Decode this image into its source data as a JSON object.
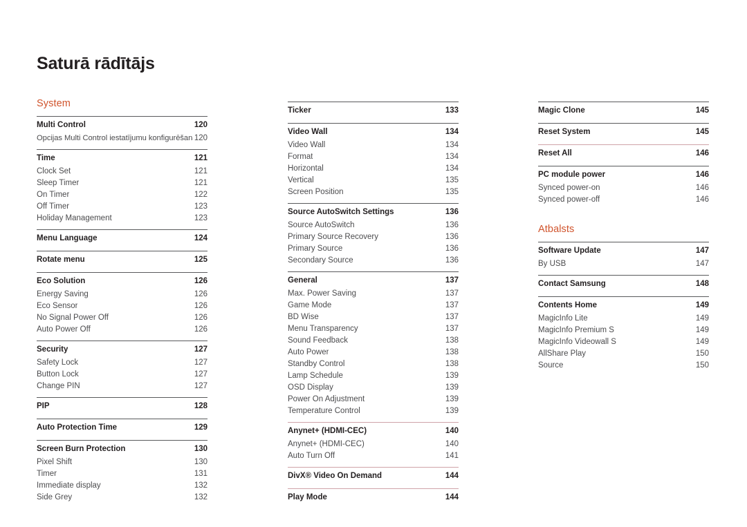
{
  "document": {
    "title": "Saturā rādītājs"
  },
  "colors": {
    "accent": "#d0532b",
    "rule": "#58595b",
    "rule_rose": "#cfa3a8",
    "text": "#231f20",
    "text_sub": "#4b4b4d",
    "background": "#ffffff"
  },
  "columns": [
    {
      "name": "column-left",
      "sections": [
        {
          "heading": "System",
          "groups": [
            {
              "rule": "dark",
              "rows": [
                {
                  "type": "main",
                  "label": "Multi Control",
                  "page": "120"
                },
                {
                  "type": "sub",
                  "label": "Opcijas Multi Control iestatījumu konfigurēšana",
                  "page": "120",
                  "tight": true
                }
              ]
            },
            {
              "rule": "dark",
              "rows": [
                {
                  "type": "main",
                  "label": "Time",
                  "page": "121"
                },
                {
                  "type": "sub",
                  "label": "Clock Set",
                  "page": "121"
                },
                {
                  "type": "sub",
                  "label": "Sleep Timer",
                  "page": "121"
                },
                {
                  "type": "sub",
                  "label": "On Timer",
                  "page": "122"
                },
                {
                  "type": "sub",
                  "label": "Off Timer",
                  "page": "123"
                },
                {
                  "type": "sub",
                  "label": "Holiday Management",
                  "page": "123"
                }
              ]
            },
            {
              "rule": "dark",
              "rows": [
                {
                  "type": "main",
                  "label": "Menu Language",
                  "page": "124"
                }
              ]
            },
            {
              "rule": "dark",
              "rows": [
                {
                  "type": "main",
                  "label": "Rotate menu",
                  "page": "125"
                }
              ]
            },
            {
              "rule": "dark",
              "rows": [
                {
                  "type": "main",
                  "label": "Eco Solution",
                  "page": "126"
                },
                {
                  "type": "sub",
                  "label": "Energy Saving",
                  "page": "126"
                },
                {
                  "type": "sub",
                  "label": "Eco Sensor",
                  "page": "126"
                },
                {
                  "type": "sub",
                  "label": "No Signal Power Off",
                  "page": "126"
                },
                {
                  "type": "sub",
                  "label": "Auto Power Off",
                  "page": "126"
                }
              ]
            },
            {
              "rule": "dark",
              "rows": [
                {
                  "type": "main",
                  "label": "Security",
                  "page": "127"
                },
                {
                  "type": "sub",
                  "label": "Safety Lock",
                  "page": "127"
                },
                {
                  "type": "sub",
                  "label": "Button Lock",
                  "page": "127"
                },
                {
                  "type": "sub",
                  "label": "Change PIN",
                  "page": "127"
                }
              ]
            },
            {
              "rule": "dark",
              "rows": [
                {
                  "type": "main",
                  "label": "PIP",
                  "page": "128"
                }
              ]
            },
            {
              "rule": "dark",
              "rows": [
                {
                  "type": "main",
                  "label": "Auto Protection Time",
                  "page": "129"
                }
              ]
            },
            {
              "rule": "dark",
              "rows": [
                {
                  "type": "main",
                  "label": "Screen Burn Protection",
                  "page": "130"
                },
                {
                  "type": "sub",
                  "label": "Pixel Shift",
                  "page": "130"
                },
                {
                  "type": "sub",
                  "label": "Timer",
                  "page": "131"
                },
                {
                  "type": "sub",
                  "label": "Immediate display",
                  "page": "132"
                },
                {
                  "type": "sub",
                  "label": "Side Grey",
                  "page": "132"
                }
              ]
            }
          ]
        }
      ]
    },
    {
      "name": "column-middle",
      "sections": [
        {
          "heading": "",
          "groups": [
            {
              "rule": "dark",
              "rows": [
                {
                  "type": "main",
                  "label": "Ticker",
                  "page": "133"
                }
              ]
            },
            {
              "rule": "dark",
              "rows": [
                {
                  "type": "main",
                  "label": "Video Wall",
                  "page": "134"
                },
                {
                  "type": "sub",
                  "label": "Video Wall",
                  "page": "134"
                },
                {
                  "type": "sub",
                  "label": "Format",
                  "page": "134"
                },
                {
                  "type": "sub",
                  "label": "Horizontal",
                  "page": "134"
                },
                {
                  "type": "sub",
                  "label": "Vertical",
                  "page": "135"
                },
                {
                  "type": "sub",
                  "label": "Screen Position",
                  "page": "135"
                }
              ]
            },
            {
              "rule": "dark",
              "rows": [
                {
                  "type": "main",
                  "label": "Source AutoSwitch Settings",
                  "page": "136"
                },
                {
                  "type": "sub",
                  "label": "Source AutoSwitch",
                  "page": "136"
                },
                {
                  "type": "sub",
                  "label": "Primary Source Recovery",
                  "page": "136"
                },
                {
                  "type": "sub",
                  "label": "Primary Source",
                  "page": "136"
                },
                {
                  "type": "sub",
                  "label": "Secondary Source",
                  "page": "136"
                }
              ]
            },
            {
              "rule": "dark",
              "rows": [
                {
                  "type": "main",
                  "label": "General",
                  "page": "137"
                },
                {
                  "type": "sub",
                  "label": "Max. Power Saving",
                  "page": "137"
                },
                {
                  "type": "sub",
                  "label": "Game Mode",
                  "page": "137"
                },
                {
                  "type": "sub",
                  "label": "BD Wise",
                  "page": "137"
                },
                {
                  "type": "sub",
                  "label": "Menu Transparency",
                  "page": "137"
                },
                {
                  "type": "sub",
                  "label": "Sound Feedback",
                  "page": "138"
                },
                {
                  "type": "sub",
                  "label": "Auto Power",
                  "page": "138"
                },
                {
                  "type": "sub",
                  "label": "Standby Control",
                  "page": "138"
                },
                {
                  "type": "sub",
                  "label": "Lamp Schedule",
                  "page": "139"
                },
                {
                  "type": "sub",
                  "label": "OSD Display",
                  "page": "139"
                },
                {
                  "type": "sub",
                  "label": "Power On Adjustment",
                  "page": "139"
                },
                {
                  "type": "sub",
                  "label": "Temperature Control",
                  "page": "139"
                }
              ]
            },
            {
              "rule": "rose",
              "rows": [
                {
                  "type": "main",
                  "label": "Anynet+ (HDMI-CEC)",
                  "page": "140"
                },
                {
                  "type": "sub",
                  "label": "Anynet+ (HDMI-CEC)",
                  "page": "140"
                },
                {
                  "type": "sub",
                  "label": "Auto Turn Off",
                  "page": "141"
                }
              ]
            },
            {
              "rule": "rose",
              "rows": [
                {
                  "type": "main",
                  "label": "DivX® Video On Demand",
                  "page": "144"
                }
              ]
            },
            {
              "rule": "rose",
              "rows": [
                {
                  "type": "main",
                  "label": "Play Mode",
                  "page": "144"
                }
              ]
            }
          ]
        }
      ]
    },
    {
      "name": "column-right",
      "sections": [
        {
          "heading": "",
          "groups": [
            {
              "rule": "dark",
              "rows": [
                {
                  "type": "main",
                  "label": "Magic Clone",
                  "page": "145"
                }
              ]
            },
            {
              "rule": "dark",
              "rows": [
                {
                  "type": "main",
                  "label": "Reset System",
                  "page": "145"
                }
              ]
            },
            {
              "rule": "rose",
              "rows": [
                {
                  "type": "main",
                  "label": "Reset All",
                  "page": "146"
                }
              ]
            },
            {
              "rule": "dark",
              "rows": [
                {
                  "type": "main",
                  "label": "PC module power",
                  "page": "146"
                },
                {
                  "type": "sub",
                  "label": "Synced power-on",
                  "page": "146"
                },
                {
                  "type": "sub",
                  "label": "Synced power-off",
                  "page": "146"
                }
              ]
            }
          ]
        },
        {
          "heading": "Atbalsts",
          "spaced": true,
          "groups": [
            {
              "rule": "dark",
              "rows": [
                {
                  "type": "main",
                  "label": "Software Update",
                  "page": "147"
                },
                {
                  "type": "sub",
                  "label": "By USB",
                  "page": "147"
                }
              ]
            },
            {
              "rule": "dark",
              "rows": [
                {
                  "type": "main",
                  "label": "Contact Samsung",
                  "page": "148"
                }
              ]
            },
            {
              "rule": "dark",
              "rows": [
                {
                  "type": "main",
                  "label": "Contents Home",
                  "page": "149"
                },
                {
                  "type": "sub",
                  "label": "MagicInfo Lite",
                  "page": "149"
                },
                {
                  "type": "sub",
                  "label": "MagicInfo Premium S",
                  "page": "149"
                },
                {
                  "type": "sub",
                  "label": "MagicInfo Videowall S",
                  "page": "149"
                },
                {
                  "type": "sub",
                  "label": "AllShare Play",
                  "page": "150"
                },
                {
                  "type": "sub",
                  "label": "Source",
                  "page": "150"
                }
              ]
            }
          ]
        }
      ]
    }
  ]
}
